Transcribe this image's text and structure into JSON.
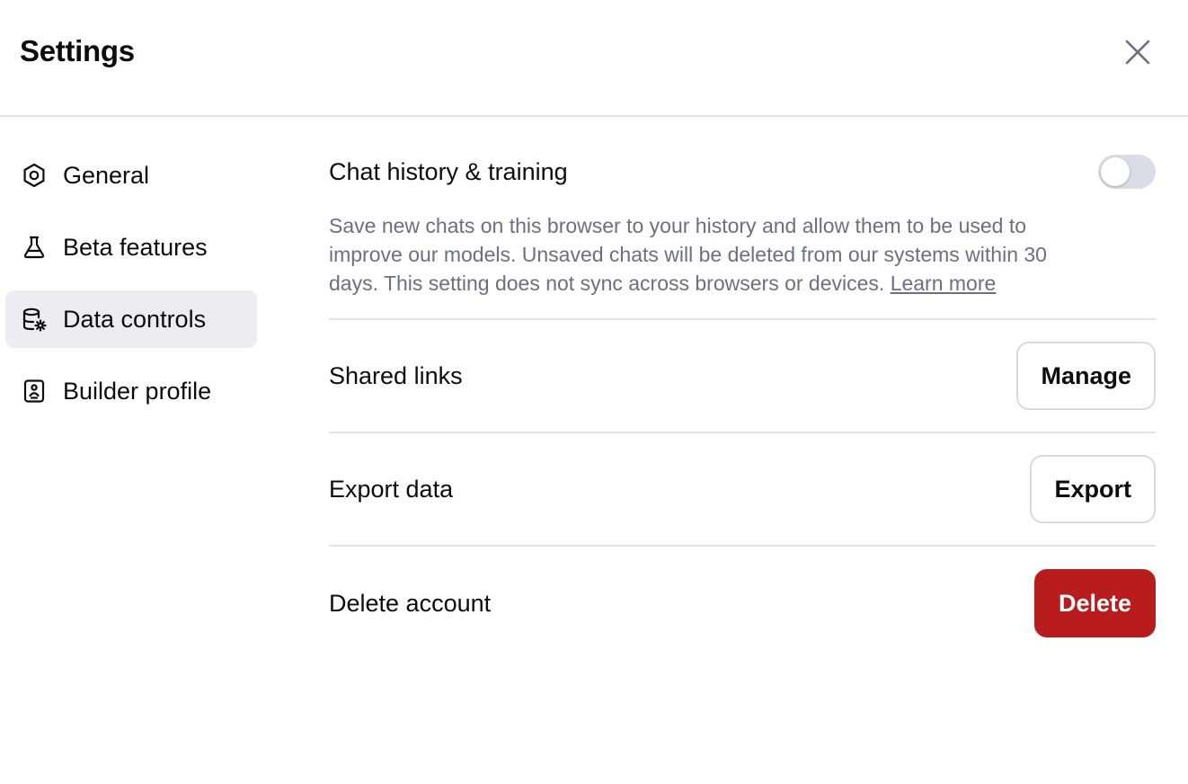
{
  "header": {
    "title": "Settings",
    "close_icon": "close-icon"
  },
  "sidebar": {
    "items": [
      {
        "label": "General",
        "icon": "gear-icon",
        "active": false
      },
      {
        "label": "Beta features",
        "icon": "flask-icon",
        "active": false
      },
      {
        "label": "Data controls",
        "icon": "database-gear-icon",
        "active": true
      },
      {
        "label": "Builder profile",
        "icon": "id-badge-icon",
        "active": false
      }
    ]
  },
  "data_controls": {
    "chat_history": {
      "title": "Chat history & training",
      "description": "Save new chats on this browser to your history and allow them to be used to improve our models. Unsaved chats will be deleted from our systems within 30 days. This setting does not sync across browsers or devices.",
      "link_text": "Learn more",
      "toggle_on": false
    },
    "shared_links": {
      "title": "Shared links",
      "button": "Manage"
    },
    "export_data": {
      "title": "Export data",
      "button": "Export"
    },
    "delete_account": {
      "title": "Delete account",
      "button": "Delete"
    }
  },
  "colors": {
    "danger": "#b91c1c",
    "active_bg": "#ececf1",
    "toggle_off": "#dcdce6",
    "muted_text": "#6e6e80"
  }
}
